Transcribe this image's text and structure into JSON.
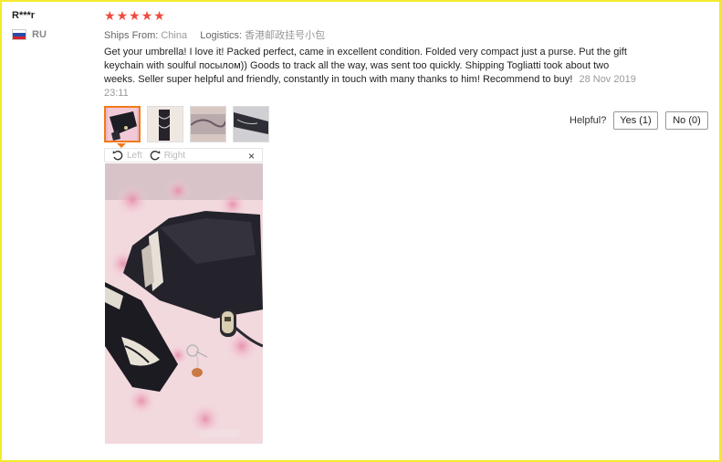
{
  "reviewer": {
    "name": "R***r",
    "country_code": "RU",
    "flag_colors": [
      "#ffffff",
      "#2c4aa8",
      "#d8242c"
    ]
  },
  "rating": {
    "stars": 5,
    "star_color": "#f04a3e",
    "glyph": "★"
  },
  "shipping": {
    "ships_from_label": "Ships From:",
    "ships_from_value": "China",
    "logistics_label": "Logistics:",
    "logistics_value": "香港邮政挂号小包"
  },
  "review": {
    "text": "Get your umbrella! I love it! Packed perfect, came in excellent condition. Folded very compact just a purse. Put the gift keychain with soulful посылом)) Goods to track all the way, was sent too quickly. Shipping Togliatti took about two weeks. Seller super helpful and friendly, constantly in touch with many thanks to him! Recommend to buy!",
    "date": "28 Nov 2019 23:11"
  },
  "photos": {
    "thumbnails": [
      "umbrella-photo-1",
      "umbrella-photo-2",
      "umbrella-photo-3",
      "umbrella-photo-4"
    ],
    "active_index": 0,
    "accent_color": "#f17a1a"
  },
  "viewer": {
    "rotate_left_label": "Left",
    "rotate_right_label": "Right",
    "close_glyph": "×"
  },
  "feedback": {
    "helpful_label": "Helpful?",
    "yes_label": "Yes (1)",
    "no_label": "No (0)"
  }
}
